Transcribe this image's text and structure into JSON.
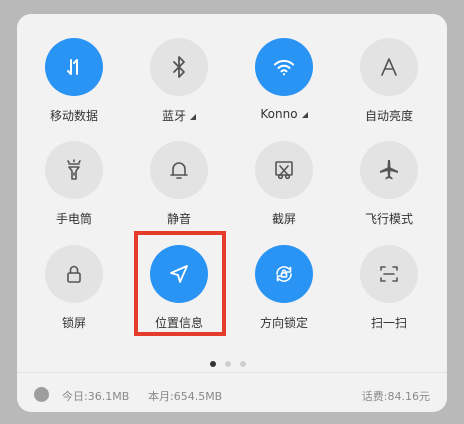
{
  "tiles": [
    {
      "label": "移动数据",
      "icon": "mobile-data-icon",
      "active": true
    },
    {
      "label": "蓝牙",
      "icon": "bluetooth-icon",
      "active": false
    },
    {
      "label": "Konno",
      "icon": "wifi-icon",
      "active": true
    },
    {
      "label": "自动亮度",
      "icon": "auto-brightness-icon",
      "active": false
    },
    {
      "label": "手电筒",
      "icon": "flashlight-icon",
      "active": false
    },
    {
      "label": "静音",
      "icon": "bell-icon",
      "active": false
    },
    {
      "label": "截屏",
      "icon": "screenshot-icon",
      "active": false
    },
    {
      "label": "飞行模式",
      "icon": "airplane-icon",
      "active": false
    },
    {
      "label": "锁屏",
      "icon": "lock-icon",
      "active": false
    },
    {
      "label": "位置信息",
      "icon": "location-icon",
      "active": true
    },
    {
      "label": "方向锁定",
      "icon": "rotation-lock-icon",
      "active": true
    },
    {
      "label": "扫一扫",
      "icon": "scan-icon",
      "active": false
    }
  ],
  "pagination": {
    "pages": 3,
    "current": 1
  },
  "footer": {
    "today": "今日:36.1MB",
    "month": "本月:654.5MB",
    "balance": "话费:84.16元"
  },
  "colors": {
    "active": "#2a94f4",
    "inactive": "#e3e3e3",
    "highlight": "#e53b2a"
  }
}
